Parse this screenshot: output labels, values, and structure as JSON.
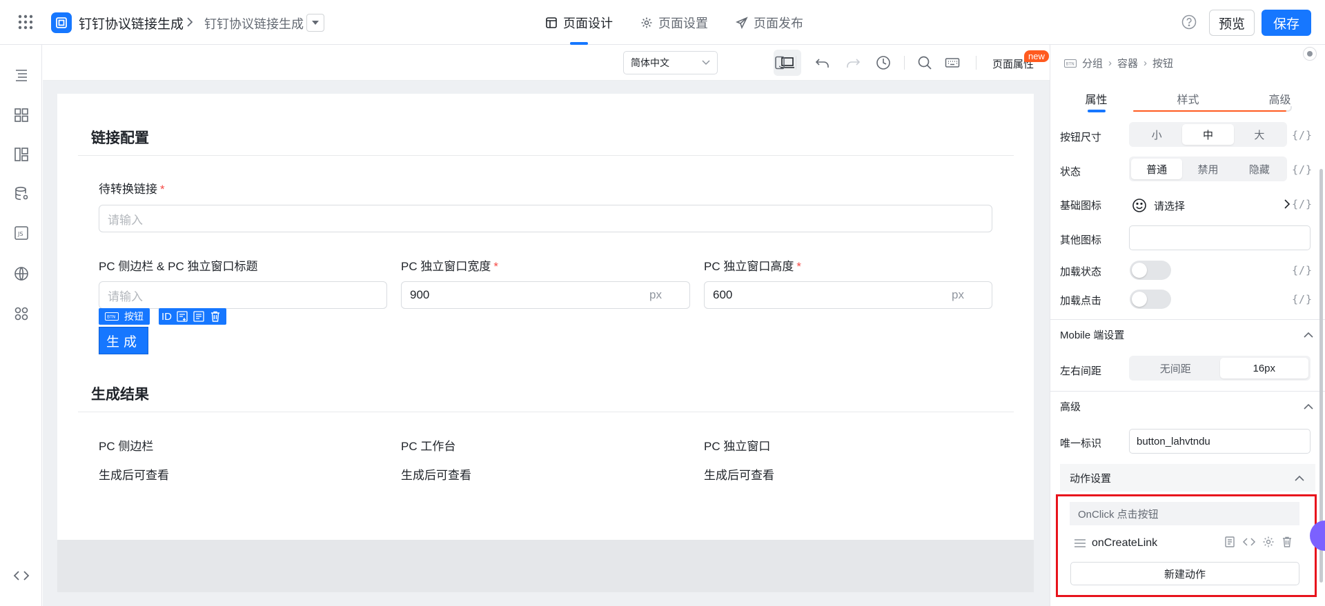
{
  "app": {
    "name": "钉钉协议链接生成",
    "page_name": "钉钉协议链接生成"
  },
  "top_tabs": [
    {
      "label": "页面设计",
      "icon": "layout-icon",
      "active": true
    },
    {
      "label": "页面设置",
      "icon": "gear-icon",
      "active": false
    },
    {
      "label": "页面发布",
      "icon": "send-icon",
      "active": false
    }
  ],
  "top_actions": {
    "preview": "预览",
    "save": "保存"
  },
  "toolbar": {
    "language": "简体中文",
    "page_attr": "页面属性",
    "new_badge": "new"
  },
  "form": {
    "section1_title": "链接配置",
    "link_label": "待转换链接",
    "link_placeholder": "请输入",
    "title_label": "PC 侧边栏 & PC 独立窗口标题",
    "title_placeholder": "请输入",
    "width_label": "PC 独立窗口宽度",
    "width_value": "900",
    "height_label": "PC 独立窗口高度",
    "height_value": "600",
    "unit": "px",
    "required_mark": "*",
    "selected_tag": "按钮",
    "selected_tag_icon": "BTN",
    "id_label": "ID",
    "generate_button": "生成"
  },
  "result": {
    "section2_title": "生成结果",
    "columns": [
      {
        "label": "PC 侧边栏",
        "value": "生成后可查看"
      },
      {
        "label": "PC 工作台",
        "value": "生成后可查看"
      },
      {
        "label": "PC 独立窗口",
        "value": "生成后可查看"
      }
    ]
  },
  "panel": {
    "breadcrumb": [
      "分组",
      "容器",
      "按钮"
    ],
    "breadcrumb_icon": "BTN",
    "tabs": [
      {
        "label": "属性",
        "active": true
      },
      {
        "label": "样式",
        "active": false
      },
      {
        "label": "高级",
        "active": false
      }
    ],
    "expr_label": "{/}",
    "button_size": {
      "label": "按钮尺寸",
      "options": [
        "小",
        "中",
        "大"
      ],
      "selected": "中"
    },
    "state": {
      "label": "状态",
      "options": [
        "普通",
        "禁用",
        "隐藏"
      ],
      "selected": "普通"
    },
    "base_icon": {
      "label": "基础图标",
      "value": "请选择"
    },
    "other_icon": {
      "label": "其他图标",
      "value": ""
    },
    "loading_state": {
      "label": "加载状态",
      "on": false
    },
    "loading_click": {
      "label": "加载点击",
      "on": false
    },
    "mobile_group": "Mobile 端设置",
    "margin": {
      "label": "左右间距",
      "options": [
        "无间距",
        "16px"
      ],
      "selected": "16px"
    },
    "advanced_group": "高级",
    "unique_id": {
      "label": "唯一标识",
      "value": "button_lahvtndu"
    },
    "action_group": "动作设置",
    "event": "OnClick 点击按钮",
    "action_name": "onCreateLink",
    "new_action": "新建动作"
  },
  "colors": {
    "accent": "#1677ff",
    "badge": "#ff5a1f",
    "highlight_box": "#e8131c"
  }
}
